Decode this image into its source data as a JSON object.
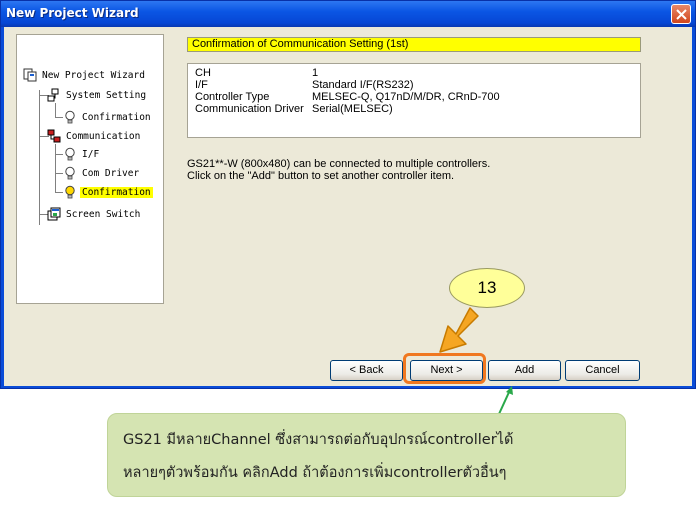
{
  "window": {
    "title": "New Project Wizard"
  },
  "tree": {
    "items": [
      {
        "label": "New Project Wizard",
        "icon": "project-icon"
      },
      {
        "label": "System Setting",
        "icon": "system-setting-icon"
      },
      {
        "label": "Confirmation",
        "icon": "lightbulb-icon"
      },
      {
        "label": "Communication",
        "icon": "communication-icon"
      },
      {
        "label": "I/F",
        "icon": "lightbulb-icon"
      },
      {
        "label": "Com Driver",
        "icon": "lightbulb-icon"
      },
      {
        "label": "Confirmation",
        "icon": "lightbulb-icon",
        "selected": true
      },
      {
        "label": "Screen Switch",
        "icon": "screen-switch-icon"
      }
    ]
  },
  "content": {
    "header": "Confirmation of Communication Setting (1st)",
    "settings": [
      {
        "key": "CH",
        "value": "1"
      },
      {
        "key": "I/F",
        "value": "Standard I/F(RS232)"
      },
      {
        "key": "Controller Type",
        "value": "MELSEC-Q, Q17nD/M/DR, CRnD-700"
      },
      {
        "key": "Communication Driver",
        "value": "Serial(MELSEC)"
      }
    ],
    "info_line1": "GS21**-W (800x480) can be connected to multiple controllers.",
    "info_line2": "Click on the \"Add\" button to set another controller item."
  },
  "buttons": {
    "back": "< Back",
    "next": "Next >",
    "add": "Add",
    "cancel": "Cancel"
  },
  "annotation": {
    "step": "13",
    "note_line1": "GS21 มีหลายChannel ซึ่งสามารถต่อกับอุปกรณ์controllerได้",
    "note_line2": "หลายๆตัวพร้อมกัน คลิกAdd ถ้าต้องการเพิ่มcontrollerตัวอื่นๆ"
  },
  "colors": {
    "title_bar": "#0b56e4",
    "dialog_bg": "#ece9d8",
    "highlight_yellow": "#ffff00",
    "next_outline": "#f07820",
    "note_bg": "#d5e4b2",
    "badge_bg": "#ffff99",
    "arrow_green": "#2aa84a",
    "arrow_orange": "#f5a623"
  }
}
